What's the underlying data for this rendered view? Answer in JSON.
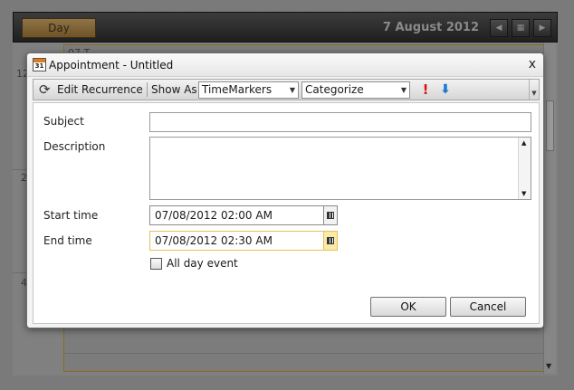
{
  "scheduler": {
    "view_tab": "Day",
    "date": "7 August 2012",
    "day_header_partial": "07 T",
    "hour_labels": [
      "12",
      "2",
      "4"
    ]
  },
  "dialog": {
    "title": "Appointment - Untitled",
    "calendar_icon_number": "31",
    "close_glyph": "x",
    "toolbar": {
      "edit_recurrence_label": "Edit Recurrence",
      "show_as_label": "Show As",
      "show_as_value": "TimeMarkers",
      "categorize_value": "Categorize",
      "priority_high_glyph": "!",
      "priority_low_glyph": "⬇",
      "priority_high_color": "#e01010",
      "priority_low_color": "#1a78d0"
    },
    "form": {
      "subject_label": "Subject",
      "subject_value": "",
      "description_label": "Description",
      "description_value": "",
      "start_label": "Start time",
      "start_value": "07/08/2012 02:00 AM",
      "end_label": "End time",
      "end_value": "07/08/2012 02:30 AM",
      "all_day_label": "All day event",
      "all_day_checked": false
    },
    "buttons": {
      "ok": "OK",
      "cancel": "Cancel"
    }
  }
}
